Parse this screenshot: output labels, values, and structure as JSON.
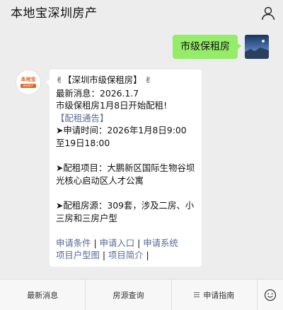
{
  "header": {
    "title": "本地宝深圳房产"
  },
  "outgoing_message": {
    "text": "市级保租房"
  },
  "bot_avatar": {
    "brand_text": "本地宝",
    "brand_sub": "深圳房产"
  },
  "incoming_message": {
    "hand_emoji": "✌",
    "title_line": "【深圳市级保租房】",
    "latest_label": "最新消息：2026.1.7",
    "latest_text": "市级保租房1月8日开始配租!",
    "notice_link": "【配租通告】",
    "apply_time": "➤申请时间：2026年1月8日9:00至19日18:00",
    "project": "➤配租项目：大鹏新区国际生物谷坝光核心启动区人才公寓",
    "units": "➤配租房源：309套，涉及二房、小三房和三房户型",
    "links": {
      "l1": "申请条件",
      "sep1": " | ",
      "l2": "申请入口",
      "sep2": " | ",
      "l3": "申请系统",
      "l4": "项目户型图",
      "sep3": " | ",
      "l5": "项目简介",
      "sep4": " |"
    }
  },
  "bottom_menu": {
    "tab1": "最新消息",
    "tab2": "房源查询",
    "tab3": "申请指南"
  },
  "colors": {
    "accent_green": "#95ec69",
    "link_blue": "#576b95",
    "brand_orange": "#e0621f"
  }
}
